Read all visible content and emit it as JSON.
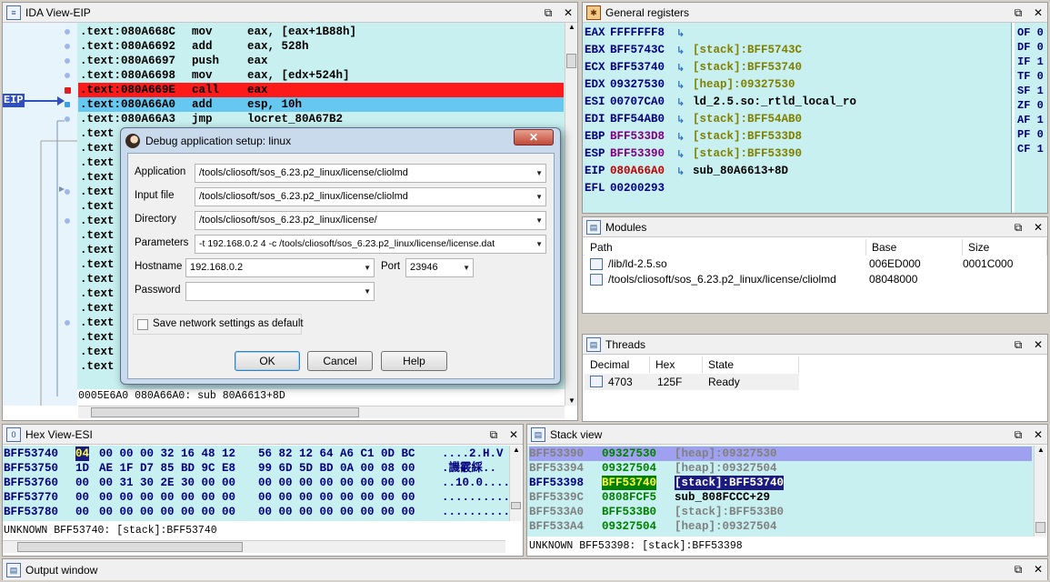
{
  "ida": {
    "title": "IDA View-EIP",
    "eip_label": "EIP",
    "lines": [
      {
        "addr": ".text:080A668C",
        "mnem": "mov",
        "ops": "eax, [eax+1B88h]",
        "hl": ""
      },
      {
        "addr": ".text:080A6692",
        "mnem": "add",
        "ops": "eax, 528h",
        "hl": ""
      },
      {
        "addr": ".text:080A6697",
        "mnem": "push",
        "ops": "eax",
        "hl": ""
      },
      {
        "addr": ".text:080A6698",
        "mnem": "mov",
        "ops": "eax, [edx+524h]",
        "hl": ""
      },
      {
        "addr": ".text:080A669E",
        "mnem": "call",
        "ops": "eax",
        "hl": "red"
      },
      {
        "addr": ".text:080A66A0",
        "mnem": "add",
        "ops": "esp, 10h",
        "hl": "blue"
      },
      {
        "addr": ".text:080A66A3",
        "mnem": "jmp",
        "ops": "locret_80A67B2",
        "hl": ""
      },
      {
        "addr": ".text",
        "mnem": "",
        "ops": "",
        "hl": ""
      },
      {
        "addr": ".text",
        "mnem": "",
        "ops": "",
        "hl": ""
      },
      {
        "addr": ".text",
        "mnem": "",
        "ops": "",
        "hl": ""
      },
      {
        "addr": ".text",
        "mnem": "",
        "ops": "",
        "hl": ""
      },
      {
        "addr": ".text",
        "mnem": "",
        "ops": "",
        "hl": ""
      },
      {
        "addr": ".text",
        "mnem": "",
        "ops": "",
        "hl": ""
      },
      {
        "addr": ".text",
        "mnem": "",
        "ops": "",
        "hl": ""
      },
      {
        "addr": ".text",
        "mnem": "",
        "ops": "",
        "hl": ""
      },
      {
        "addr": ".text",
        "mnem": "",
        "ops": "",
        "hl": ""
      },
      {
        "addr": ".text",
        "mnem": "",
        "ops": "",
        "hl": ""
      },
      {
        "addr": ".text",
        "mnem": "",
        "ops": "",
        "hl": ""
      },
      {
        "addr": ".text",
        "mnem": "",
        "ops": "",
        "hl": ""
      },
      {
        "addr": ".text",
        "mnem": "",
        "ops": "",
        "hl": ""
      },
      {
        "addr": ".text",
        "mnem": "",
        "ops": "",
        "hl": ""
      },
      {
        "addr": ".text",
        "mnem": "",
        "ops": "",
        "hl": ""
      },
      {
        "addr": ".text",
        "mnem": "",
        "ops": "",
        "hl": ""
      },
      {
        "addr": ".text",
        "mnem": "",
        "ops": "",
        "hl": ""
      }
    ],
    "status": "0005E6A0 080A66A0: sub 80A6613+8D"
  },
  "registers": {
    "title": "General registers",
    "rows": [
      {
        "name": "EAX",
        "value": "FFFFFFF8",
        "arrow": true,
        "ref": "",
        "ref_color": "#000000",
        "value_color": "#000080"
      },
      {
        "name": "EBX",
        "value": "BFF5743C",
        "arrow": true,
        "ref": "[stack]:BFF5743C",
        "ref_color": "#808000",
        "value_color": "#000080"
      },
      {
        "name": "ECX",
        "value": "BFF53740",
        "arrow": true,
        "ref": "[stack]:BFF53740",
        "ref_color": "#808000",
        "value_color": "#000080"
      },
      {
        "name": "EDX",
        "value": "09327530",
        "arrow": true,
        "ref": "[heap]:09327530",
        "ref_color": "#808000",
        "value_color": "#000080"
      },
      {
        "name": "ESI",
        "value": "00707CA0",
        "arrow": true,
        "ref": "ld_2.5.so:_rtld_local_ro",
        "ref_color": "#000000",
        "value_color": "#000080"
      },
      {
        "name": "EDI",
        "value": "BFF54AB0",
        "arrow": true,
        "ref": "[stack]:BFF54AB0",
        "ref_color": "#808000",
        "value_color": "#000080"
      },
      {
        "name": "EBP",
        "value": "BFF533D8",
        "arrow": true,
        "ref": "[stack]:BFF533D8",
        "ref_color": "#808000",
        "value_color": "#800080"
      },
      {
        "name": "ESP",
        "value": "BFF53390",
        "arrow": true,
        "ref": "[stack]:BFF53390",
        "ref_color": "#808000",
        "value_color": "#800080"
      },
      {
        "name": "EIP",
        "value": "080A66A0",
        "arrow": true,
        "ref": "sub_80A6613+8D",
        "ref_color": "#000000",
        "value_color": "#c00000"
      },
      {
        "name": "EFL",
        "value": "00200293",
        "arrow": false,
        "ref": "",
        "ref_color": "#000000",
        "value_color": "#000080"
      }
    ],
    "flags": [
      "OF 0",
      "DF 0",
      "IF 1",
      "TF 0",
      "SF 1",
      "ZF 0",
      "AF 1",
      "PF 0",
      "CF 1"
    ]
  },
  "modules": {
    "title": "Modules",
    "columns": [
      "Path",
      "Base",
      "Size"
    ],
    "rows": [
      {
        "path": "/lib/ld-2.5.so",
        "base": "006ED000",
        "size": "0001C000"
      },
      {
        "path": "/tools/cliosoft/sos_6.23.p2_linux/license/cliolmd",
        "base": "08048000",
        "size": ""
      }
    ]
  },
  "threads": {
    "title": "Threads",
    "columns": [
      "Decimal",
      "Hex",
      "State"
    ],
    "rows": [
      {
        "decimal": "4703",
        "hex": "125F",
        "state": "Ready"
      }
    ]
  },
  "hex": {
    "title": "Hex View-ESI",
    "rows": [
      {
        "addr": "BFF53740",
        "b1": "04",
        "rest1": "00 00 00 32 16 48 12",
        "bytes2": "56 82 12 64 A6 C1 0D BC",
        "ascii": "....2.H.V"
      },
      {
        "addr": "BFF53750",
        "b1": "1D",
        "rest1": "AE 1F D7 85 BD 9C E8",
        "bytes2": "99 6D 5D BD 0A 00 08 00",
        "ascii": ".譏霰綵.."
      },
      {
        "addr": "BFF53760",
        "b1": "00",
        "rest1": "00 31 30 2E 30 00 00",
        "bytes2": "00 00 00 00 00 00 00 00",
        "ascii": "..10.0...."
      },
      {
        "addr": "BFF53770",
        "b1": "00",
        "rest1": "00 00 00 00 00 00 00",
        "bytes2": "00 00 00 00 00 00 00 00",
        "ascii": ".........."
      },
      {
        "addr": "BFF53780",
        "b1": "00",
        "rest1": "00 00 00 00 00 00 00",
        "bytes2": "00 00 00 00 00 00 00 00",
        "ascii": ".........."
      }
    ],
    "status": "UNKNOWN BFF53740: [stack]:BFF53740"
  },
  "stack": {
    "title": "Stack view",
    "rows": [
      {
        "addr": "BFF53390",
        "val": "09327530",
        "ref": "[heap]:09327530"
      },
      {
        "addr": "BFF53394",
        "val": "09327504",
        "ref": "[heap]:09327504"
      },
      {
        "addr": "BFF53398",
        "val": "BFF53740",
        "ref": "[stack]:BFF53740"
      },
      {
        "addr": "BFF5339C",
        "val": "0808FCF5",
        "ref": "sub_808FCCC+29"
      },
      {
        "addr": "BFF533A0",
        "val": "BFF533B0",
        "ref": "[stack]:BFF533B0"
      },
      {
        "addr": "BFF533A4",
        "val": "09327504",
        "ref": "[heap]:09327504"
      }
    ],
    "status": "UNKNOWN BFF53398: [stack]:BFF53398"
  },
  "output": {
    "title": "Output window"
  },
  "dialog": {
    "title": "Debug application setup: linux",
    "application_label": "Application",
    "application_value": "/tools/cliosoft/sos_6.23.p2_linux/license/cliolmd",
    "input_label": "Input file",
    "input_value": "/tools/cliosoft/sos_6.23.p2_linux/license/cliolmd",
    "directory_label": "Directory",
    "directory_value": "/tools/cliosoft/sos_6.23.p2_linux/license/",
    "parameters_label": "Parameters",
    "parameters_value": "-t 192.168.0.2 4 -c /tools/cliosoft/sos_6.23.p2_linux/license/license.dat",
    "hostname_label": "Hostname",
    "hostname_value": "192.168.0.2",
    "port_label": "Port",
    "port_value": "23946",
    "password_label": "Password",
    "password_value": "",
    "save_label": "Save network settings as default",
    "ok": "OK",
    "cancel": "Cancel",
    "help": "Help"
  }
}
